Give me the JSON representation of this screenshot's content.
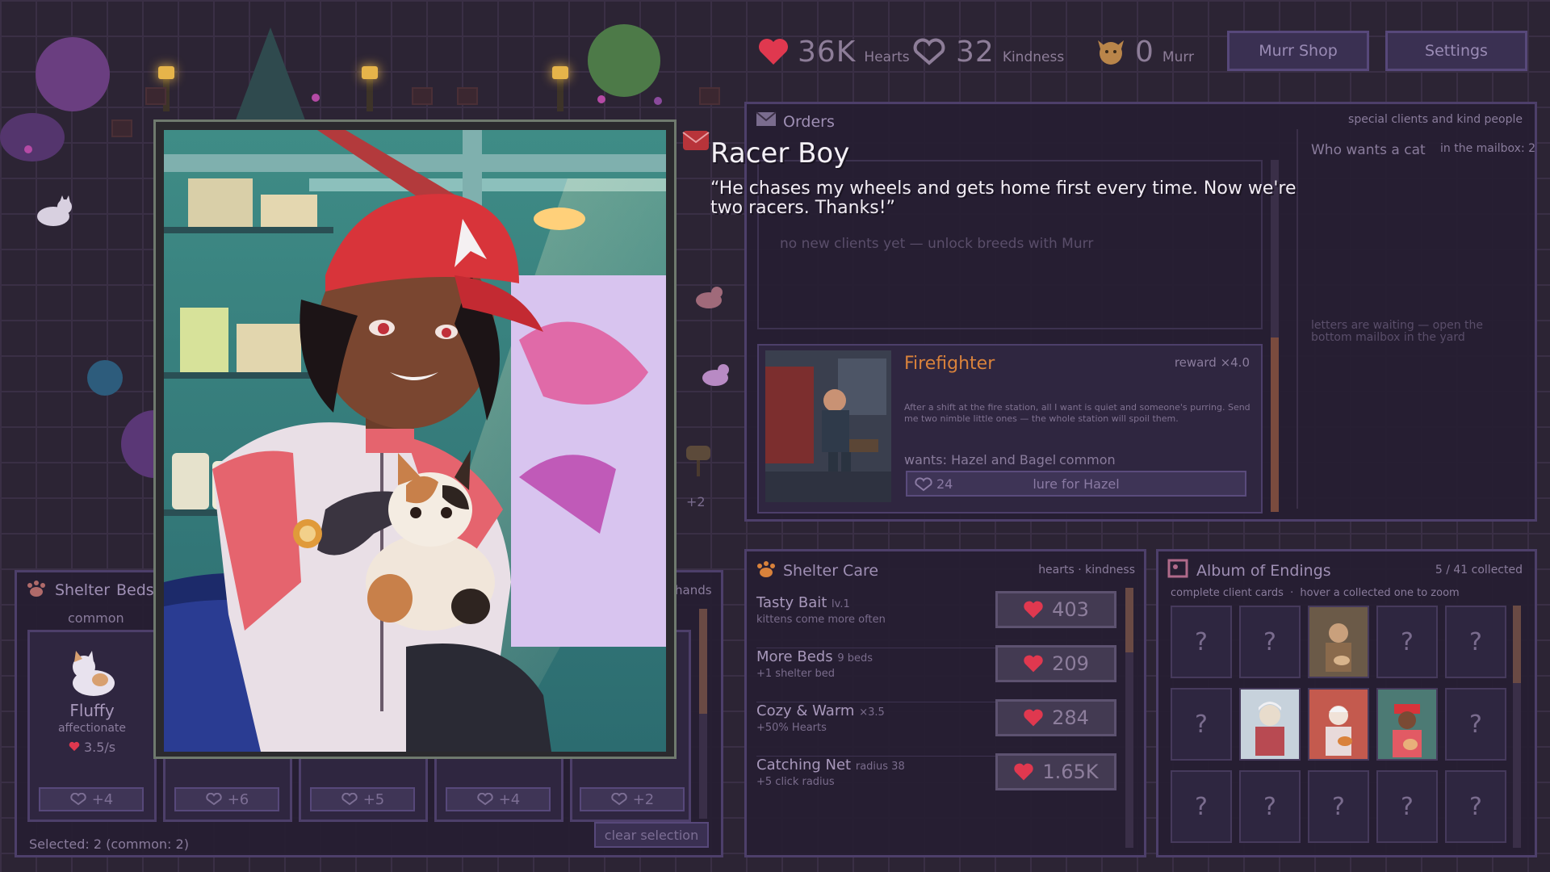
{
  "currency": {
    "hearts": {
      "value": "36K",
      "label": "Hearts"
    },
    "kindness": {
      "value": "32",
      "label": "Kindness"
    },
    "murr": {
      "value": "0",
      "label": "Murr"
    }
  },
  "top_buttons": {
    "murr_shop": "Murr Shop",
    "settings": "Settings"
  },
  "orders": {
    "title": "Orders",
    "subtitle": "special clients and kind people",
    "mailbox_heading": "Who wants a cat",
    "mailbox_count": "in the mailbox: 2",
    "empty_clients": "no new clients yet — unlock breeds with Murr",
    "letters_hint": "letters are waiting — open the bottom mailbox in the yard",
    "card": {
      "name": "Firefighter",
      "reward": "reward ×4.0",
      "description": "After a shift at the fire station, all I want is quiet and someone's purring. Send me two nimble little ones — the whole station will spoil them.",
      "wants": "wants: Hazel and Bagel",
      "rarity": "common",
      "cost": "24",
      "button": "lure for Hazel"
    }
  },
  "ending": {
    "name": "Racer Boy",
    "quote": "“He chases my wheels and gets home first every time. Now we're two racers. Thanks!”"
  },
  "shelter_care": {
    "title": "Shelter Care",
    "legend_a": "hearts",
    "legend_sep": "·",
    "legend_b": "kindness",
    "items": [
      {
        "name": "Tasty Bait",
        "tag": "lv.1",
        "sub": "kittens come more often",
        "cost": "403"
      },
      {
        "name": "More Beds",
        "tag": "9 beds",
        "sub": "+1 shelter bed",
        "cost": "209"
      },
      {
        "name": "Cozy & Warm",
        "tag": "×3.5",
        "sub": "+50% Hearts",
        "cost": "284"
      },
      {
        "name": "Catching Net",
        "tag": "radius 38",
        "sub": "+5 click radius",
        "cost": "1.65K"
      }
    ]
  },
  "album": {
    "title": "Album of Endings",
    "collected": "5 / 41 collected",
    "hint_a": "complete client cards",
    "hint_b": "hover a collected one to zoom",
    "unknown": "?"
  },
  "shelter": {
    "title": "Shelter",
    "beds_label": "Beds:",
    "rarity": "common",
    "hands": "hands",
    "cat": {
      "name": "Fluffy",
      "trait": "affectionate",
      "rate": "3.5/s"
    },
    "bed_buttons": [
      "+4",
      "+6",
      "+5",
      "+4",
      "+2"
    ],
    "selected": "Selected: 2 (common: 2)",
    "clear": "clear selection"
  },
  "misc": {
    "plus_two": "+2"
  },
  "colors": {
    "heart": "#e0384f",
    "accent_orange": "#d9823b",
    "panel_border": "#4d3f6a"
  }
}
